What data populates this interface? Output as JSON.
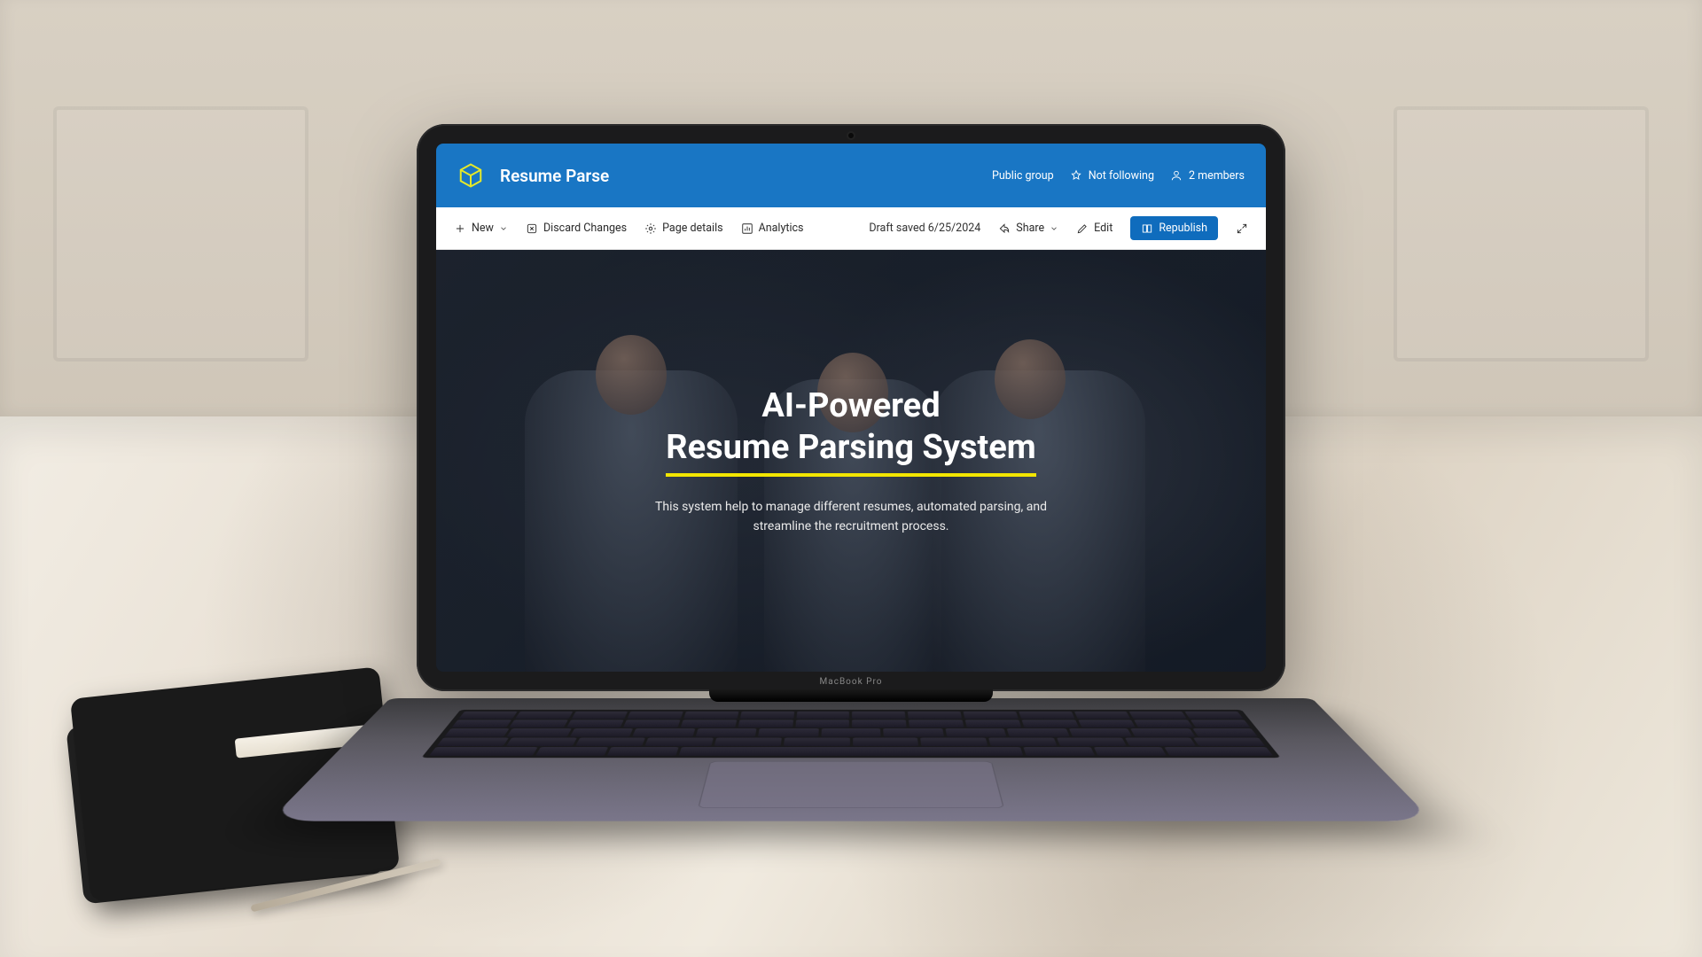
{
  "header": {
    "site_title": "Resume Parse",
    "public_group": "Public group",
    "not_following": "Not following",
    "members": "2 members"
  },
  "toolbar": {
    "new": "New",
    "discard": "Discard Changes",
    "page_details": "Page details",
    "analytics": "Analytics",
    "draft_saved": "Draft saved 6/25/2024",
    "share": "Share",
    "edit": "Edit",
    "republish": "Republish"
  },
  "hero": {
    "title_line1": "AI-Powered",
    "title_line2": "Resume Parsing System",
    "subtitle": "This system help to manage different resumes, automated parsing, and streamline the recruitment process."
  },
  "device": {
    "brand": "MacBook Pro"
  }
}
